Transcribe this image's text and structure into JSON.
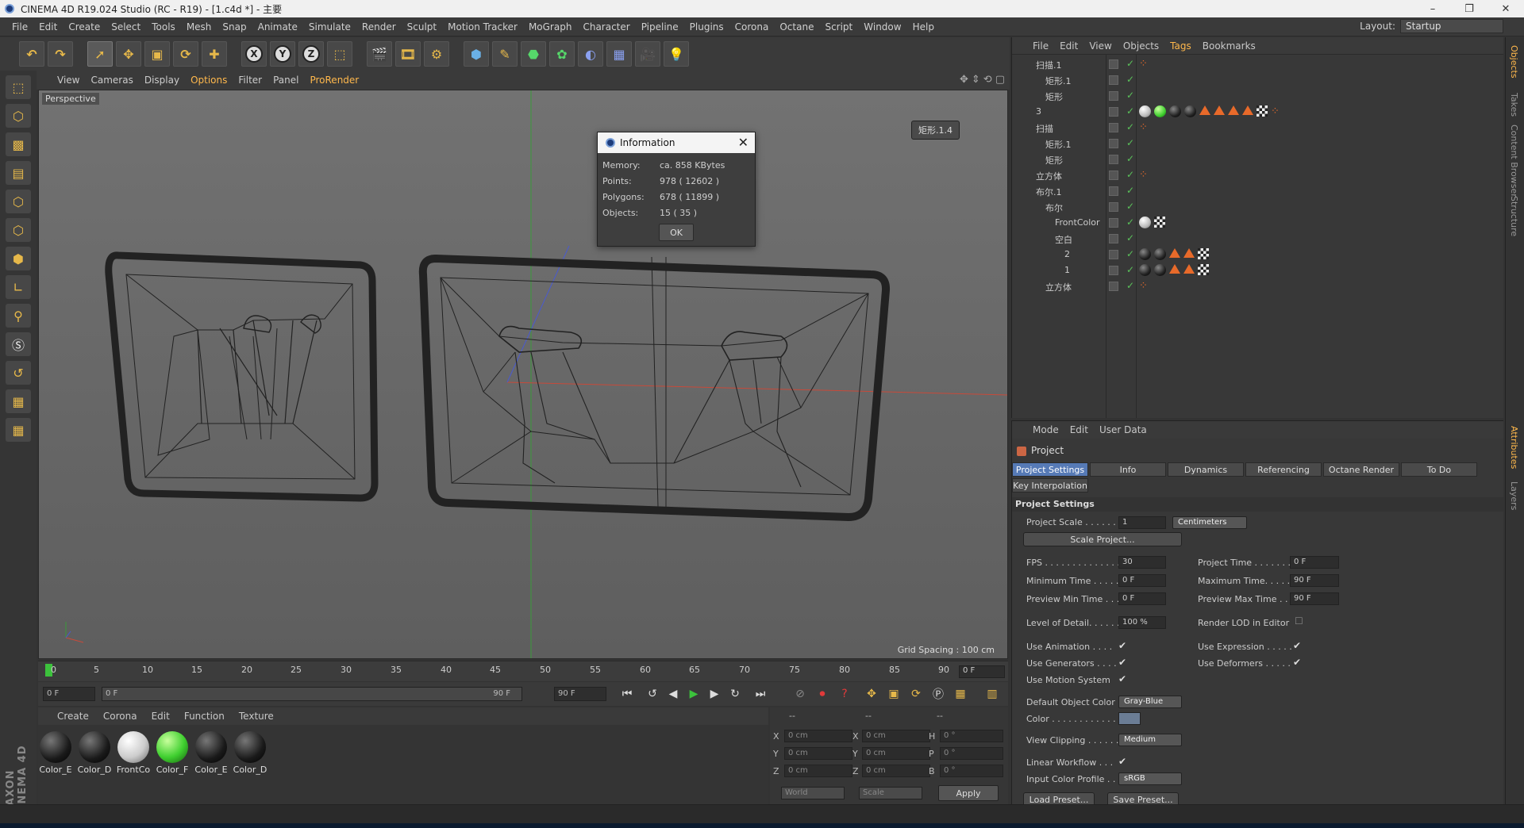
{
  "title": "CINEMA 4D R19.024 Studio (RC - R19) - [1.c4d *] - 主要",
  "menu": [
    "File",
    "Edit",
    "Create",
    "Select",
    "Tools",
    "Mesh",
    "Snap",
    "Animate",
    "Simulate",
    "Render",
    "Sculpt",
    "Motion Tracker",
    "MoGraph",
    "Character",
    "Pipeline",
    "Plugins",
    "Corona",
    "Octane",
    "Script",
    "Window",
    "Help"
  ],
  "layout": {
    "label": "Layout:",
    "value": "Startup"
  },
  "toolbar": [
    "X",
    "Y",
    "Z"
  ],
  "viewport": {
    "menu": [
      "View",
      "Cameras",
      "Display",
      "Options",
      "Filter",
      "Panel",
      "ProRender"
    ],
    "label": "Perspective",
    "grid_spacing": "Grid Spacing : 100 cm",
    "chip": "矩形.1.4"
  },
  "dialog": {
    "title": "Information",
    "rows": [
      {
        "k": "Memory:",
        "v": "ca. 858 KBytes"
      },
      {
        "k": "Points:",
        "v": "978 ( 12602 )"
      },
      {
        "k": "Polygons:",
        "v": "678 ( 11899 )"
      },
      {
        "k": "Objects:",
        "v": "15 ( 35 )"
      }
    ],
    "ok": "OK"
  },
  "timeline": {
    "ticks": [
      "0",
      "5",
      "10",
      "15",
      "20",
      "25",
      "30",
      "35",
      "40",
      "45",
      "50",
      "55",
      "60",
      "65",
      "70",
      "75",
      "80",
      "85",
      "90"
    ],
    "frame": "0 F",
    "start": "0 F",
    "range_start": "0 F",
    "range_end": "90 F",
    "end": "90 F"
  },
  "materials": {
    "menu": [
      "Create",
      "Corona",
      "Edit",
      "Function",
      "Texture"
    ],
    "items": [
      {
        "name": "Color_E",
        "color": "#2a2a2a"
      },
      {
        "name": "Color_D",
        "color": "#2a2a2a"
      },
      {
        "name": "FrontCo",
        "color": "#dddddd"
      },
      {
        "name": "Color_F",
        "color": "#3fcf2f"
      },
      {
        "name": "Color_E",
        "color": "#2a2a2a"
      },
      {
        "name": "Color_D",
        "color": "#2a2a2a"
      }
    ]
  },
  "coords": {
    "header": [
      "--",
      "--",
      "--"
    ],
    "rows": [
      {
        "a": "X",
        "av": "0 cm",
        "b": "X",
        "bv": "0 cm",
        "c": "H",
        "cv": "0 °"
      },
      {
        "a": "Y",
        "av": "0 cm",
        "b": "Y",
        "bv": "0 cm",
        "c": "P",
        "cv": "0 °"
      },
      {
        "a": "Z",
        "av": "0 cm",
        "b": "Z",
        "bv": "0 cm",
        "c": "B",
        "cv": "0 °"
      }
    ],
    "world": "World",
    "scale": "Scale",
    "apply": "Apply"
  },
  "objects": {
    "menu": [
      "File",
      "Edit",
      "View",
      "Objects",
      "Tags",
      "Bookmarks"
    ],
    "rows": [
      {
        "name": "扫描.1",
        "indent": 0,
        "tags": [
          "dots"
        ]
      },
      {
        "name": "矩形.1",
        "indent": 1,
        "tags": []
      },
      {
        "name": "矩形",
        "indent": 1,
        "tags": []
      },
      {
        "name": "3",
        "indent": 0,
        "tags": [
          "white",
          "green",
          "black",
          "black",
          "tri",
          "tri",
          "tri",
          "tri",
          "check",
          "dots"
        ]
      },
      {
        "name": "扫描",
        "indent": 0,
        "tags": [
          "dots"
        ]
      },
      {
        "name": "矩形.1",
        "indent": 1,
        "tags": []
      },
      {
        "name": "矩形",
        "indent": 1,
        "tags": []
      },
      {
        "name": "立方体",
        "indent": 0,
        "tags": [
          "dots"
        ]
      },
      {
        "name": "布尔.1",
        "indent": 0,
        "tags": []
      },
      {
        "name": "布尔",
        "indent": 1,
        "tags": []
      },
      {
        "name": "FrontColor",
        "indent": 2,
        "tags": [
          "white",
          "check"
        ]
      },
      {
        "name": "空白",
        "indent": 2,
        "tags": []
      },
      {
        "name": "2",
        "indent": 3,
        "tags": [
          "black",
          "black",
          "tri",
          "tri",
          "check"
        ]
      },
      {
        "name": "1",
        "indent": 3,
        "tags": [
          "black",
          "black",
          "tri",
          "tri",
          "check"
        ]
      },
      {
        "name": "立方体",
        "indent": 1,
        "tags": [
          "dots"
        ]
      }
    ]
  },
  "sidetabs": [
    "Objects",
    "Takes",
    "Content Browser",
    "Structure",
    "Attributes",
    "Layers"
  ],
  "attributes": {
    "menu": [
      "Mode",
      "Edit",
      "User Data"
    ],
    "title": "Project",
    "tabs": [
      "Project Settings",
      "Info",
      "Dynamics",
      "Referencing",
      "Octane Render",
      "To Do"
    ],
    "key_interp": "Key Interpolation",
    "section": "Project Settings",
    "project_scale": {
      "label": "Project Scale . . . . . .",
      "value": "1",
      "unit": "Centimeters"
    },
    "scale_project": "Scale Project...",
    "fps": {
      "label": "FPS . . . . . . . . . . . . . .",
      "value": "30"
    },
    "project_time": {
      "label": "Project Time . . . . . . .",
      "value": "0 F"
    },
    "min_time": {
      "label": "Minimum Time . . . . .",
      "value": "0 F"
    },
    "max_time": {
      "label": "Maximum Time. . . . . .",
      "value": "90 F"
    },
    "prev_min": {
      "label": "Preview Min Time . . .",
      "value": "0 F"
    },
    "prev_max": {
      "label": "Preview Max Time . .",
      "value": "90 F"
    },
    "lod": {
      "label": "Level of Detail. . . . . .",
      "value": "100 %"
    },
    "render_lod": "Render LOD in Editor",
    "use_anim": "Use Animation . . . .",
    "use_expr": "Use Expression . . . . .",
    "use_gen": "Use Generators . . . .",
    "use_def": "Use Deformers . . . . .",
    "use_motion": "Use Motion System",
    "def_color": {
      "label": "Default Object Color",
      "value": "Gray-Blue"
    },
    "color": "Color . . . . . . . . . . . .",
    "view_clip": {
      "label": "View Clipping . . . . . .",
      "value": "Medium"
    },
    "linear": "Linear Workflow . . .",
    "input_profile": {
      "label": "Input Color Profile . .",
      "value": "sRGB"
    },
    "load_preset": "Load Preset...",
    "save_preset": "Save Preset..."
  }
}
